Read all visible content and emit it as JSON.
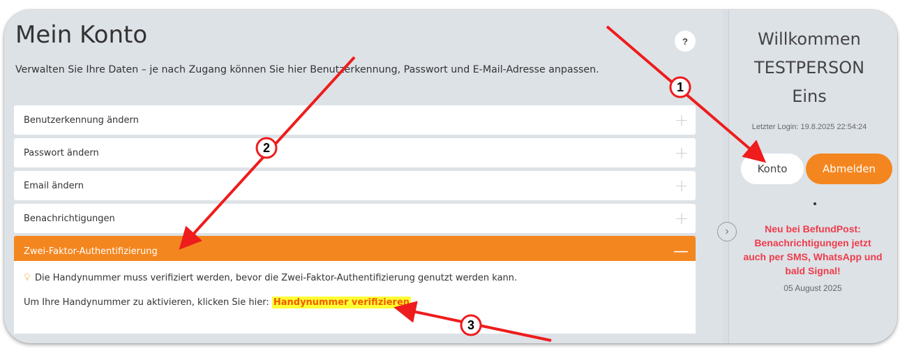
{
  "main": {
    "title": "Mein Konto",
    "help_label": "?",
    "subtitle": "Verwalten Sie Ihre Daten – je nach Zugang können Sie hier Benutzerkennung, Passwort und E-Mail-Adresse anpassen.",
    "accordion": [
      {
        "label": "Benutzerkennung ändern",
        "icon": "+"
      },
      {
        "label": "Passwort ändern",
        "icon": "+"
      },
      {
        "label": "Email ändern",
        "icon": "+"
      },
      {
        "label": "Benachrichtigungen",
        "icon": "+"
      },
      {
        "label": "Zwei-Faktor-Authentifizierung",
        "icon": "—"
      }
    ],
    "twofa": {
      "notice": "Die Handynummer muss verifiziert werden, bevor die Zwei-Faktor-Authentifizierung genutzt werden kann.",
      "activate_text": "Um Ihre Handynummer zu aktivieren, klicken Sie hier:",
      "verify_link": "Handynummer verifizieren"
    }
  },
  "sidebar": {
    "welcome_line1": "Willkommen",
    "welcome_line2": "TESTPERSON",
    "welcome_line3": "Eins",
    "last_login": "Letzter Login: 19.8.2025 22:54:24",
    "konto_button": "Konto",
    "logout_button": "Abmelden",
    "news_line1": "Neu bei BefundPost:",
    "news_line2": "Benachrichtigungen jetzt",
    "news_line3": "auch per SMS, WhatsApp und",
    "news_line4": "bald Signal!",
    "news_date": "05 August 2025",
    "collapse_icon": "chevron-right-icon"
  },
  "annotations": [
    "1",
    "2",
    "3"
  ],
  "colors": {
    "accent": "#f4861f",
    "news_red": "#ef3b4a",
    "highlight": "#ffff33",
    "arrow_red": "#ee1c1c"
  }
}
